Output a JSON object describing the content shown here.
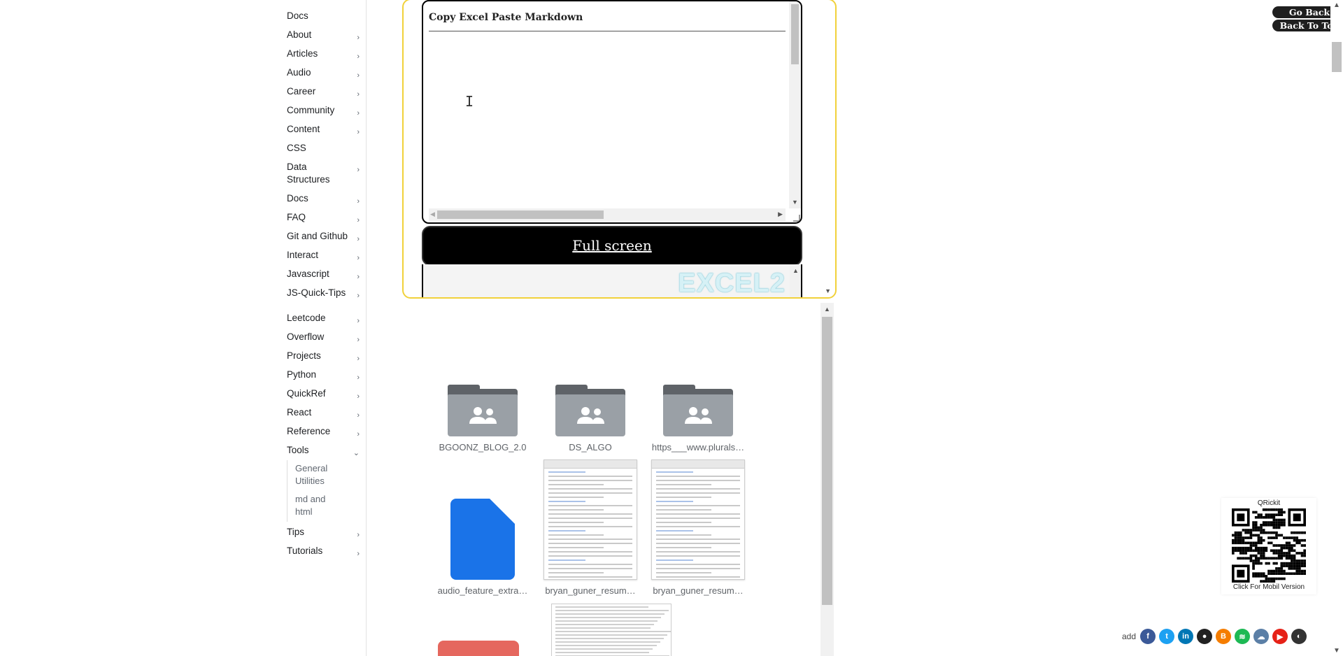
{
  "sidebar": {
    "items": [
      {
        "label": "Docs",
        "has_children": false
      },
      {
        "label": "About",
        "has_children": true
      },
      {
        "label": "Articles",
        "has_children": true
      },
      {
        "label": "Audio",
        "has_children": true
      },
      {
        "label": "Career",
        "has_children": true
      },
      {
        "label": "Community",
        "has_children": true
      },
      {
        "label": "Content",
        "has_children": true
      },
      {
        "label": "CSS",
        "has_children": false
      },
      {
        "label": "Data Structures",
        "has_children": true
      },
      {
        "label": "Docs",
        "has_children": true
      },
      {
        "label": "FAQ",
        "has_children": true
      },
      {
        "label": "Git and Github",
        "has_children": true
      },
      {
        "label": "Interact",
        "has_children": true
      },
      {
        "label": "Javascript",
        "has_children": true
      },
      {
        "label": "JS-Quick-Tips",
        "has_children": true
      },
      {
        "label": "Leetcode",
        "has_children": true
      },
      {
        "label": "Overflow",
        "has_children": true
      },
      {
        "label": "Projects",
        "has_children": true
      },
      {
        "label": "Python",
        "has_children": true
      },
      {
        "label": "QuickRef",
        "has_children": true
      },
      {
        "label": "React",
        "has_children": true
      },
      {
        "label": "Reference",
        "has_children": true
      },
      {
        "label": "Tools",
        "has_children": true,
        "expanded": true
      },
      {
        "label": "Tips",
        "has_children": true
      },
      {
        "label": "Tutorials",
        "has_children": true
      }
    ],
    "tools_children": [
      "General Utilities",
      "md and html"
    ],
    "chevron_collapsed": "›",
    "chevron_expanded": "⌄"
  },
  "editor": {
    "title": "Copy Excel Paste Markdown",
    "fullscreen_label": "Full screen",
    "preview_text": "EXCEL2"
  },
  "files": [
    {
      "name": "BGOONZ_BLOG_2.0",
      "kind": "shared-folder"
    },
    {
      "name": "DS_ALGO",
      "kind": "shared-folder"
    },
    {
      "name": "https___www.plurals…",
      "kind": "shared-folder"
    },
    {
      "name": "audio_feature_extra…",
      "kind": "doc"
    },
    {
      "name": "bryan_guner_resum…",
      "kind": "resume"
    },
    {
      "name": "bryan_guner_resum…",
      "kind": "resume"
    }
  ],
  "header_buttons": {
    "go_back": "Go Back",
    "back_to_top": "Back To Top"
  },
  "qr": {
    "title": "QRickit",
    "caption": "Click For Mobil Version"
  },
  "social": {
    "add_label": "add",
    "icons": [
      {
        "name": "facebook-icon",
        "glyph": "f",
        "color": "#3b5998"
      },
      {
        "name": "twitter-icon",
        "glyph": "t",
        "color": "#1da1f2"
      },
      {
        "name": "linkedin-icon",
        "glyph": "in",
        "color": "#0077b5"
      },
      {
        "name": "github-icon",
        "glyph": "●",
        "color": "#222222"
      },
      {
        "name": "blogger-icon",
        "glyph": "B",
        "color": "#f57d00"
      },
      {
        "name": "spotify-icon",
        "glyph": "≋",
        "color": "#1db954"
      },
      {
        "name": "cloud-icon",
        "glyph": "☁",
        "color": "#5b7fa6"
      },
      {
        "name": "youtube-icon",
        "glyph": "▶",
        "color": "#e62117"
      },
      {
        "name": "medium-icon",
        "glyph": "◐",
        "color": "#333333"
      }
    ]
  }
}
